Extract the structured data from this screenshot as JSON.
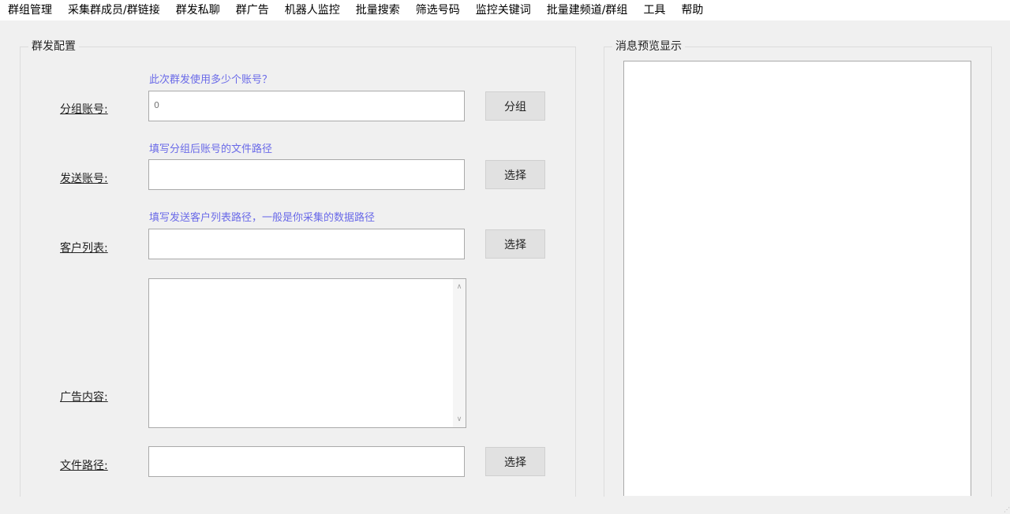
{
  "menu": [
    "群组管理",
    "采集群成员/群链接",
    "群发私聊",
    "群广告",
    "机器人监控",
    "批量搜索",
    "筛选号码",
    "监控关键词",
    "批量建频道/群组",
    "工具",
    "帮助"
  ],
  "config": {
    "title": "群发配置",
    "group_account": {
      "hint": "此次群发使用多少个账号？",
      "label": "分组账号:",
      "value": "0",
      "button": "分组"
    },
    "send_account": {
      "hint": "填写分组后账号的文件路径",
      "label": "发送账号:",
      "value": "",
      "button": "选择"
    },
    "customer_list": {
      "hint": "填写发送客户列表路径，一般是你采集的数据路径",
      "label": "客户列表:",
      "value": "",
      "button": "选择"
    },
    "ad_content": {
      "label": "广告内容:",
      "value": ""
    },
    "file_path": {
      "label": "文件路径:",
      "value": "",
      "button": "选择"
    }
  },
  "preview": {
    "title": "消息预览显示"
  }
}
